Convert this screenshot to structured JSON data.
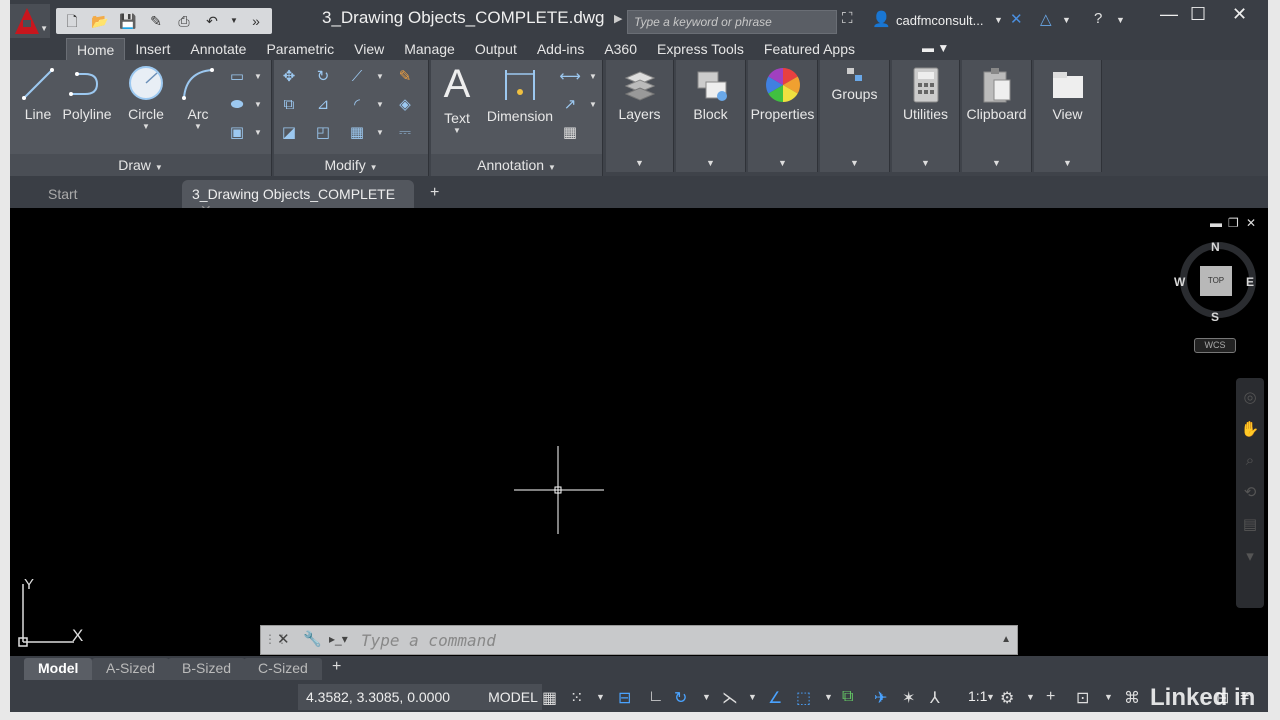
{
  "title_bar": {
    "document_title": "3_Drawing Objects_COMPLETE.dwg",
    "search_placeholder": "Type a keyword or phrase",
    "user_name": "cadfmconsult..."
  },
  "ribbon_tabs": [
    "Home",
    "Insert",
    "Annotate",
    "Parametric",
    "View",
    "Manage",
    "Output",
    "Add-ins",
    "A360",
    "Express Tools",
    "Featured Apps"
  ],
  "active_tab": "Home",
  "draw_panel": {
    "title": "Draw",
    "tools": [
      "Line",
      "Polyline",
      "Circle",
      "Arc"
    ]
  },
  "modify_panel": {
    "title": "Modify"
  },
  "annotation_panel": {
    "title": "Annotation",
    "tools": [
      "Text",
      "Dimension"
    ]
  },
  "big_panels": [
    "Layers",
    "Block",
    "Properties",
    "Groups",
    "Utilities",
    "Clipboard",
    "View"
  ],
  "file_tabs": [
    {
      "label": "Start",
      "active": false
    },
    {
      "label": "3_Drawing Objects_COMPLETE",
      "active": true
    }
  ],
  "viewcube": {
    "north": "N",
    "south": "S",
    "east": "E",
    "west": "W",
    "face": "TOP",
    "ucs": "WCS"
  },
  "ucs_icon": {
    "x": "X",
    "y": "Y"
  },
  "command_line": {
    "placeholder": "Type a command"
  },
  "layout_tabs": [
    {
      "label": "Model",
      "active": true
    },
    {
      "label": "A-Sized",
      "active": false
    },
    {
      "label": "B-Sized",
      "active": false
    },
    {
      "label": "C-Sized",
      "active": false
    }
  ],
  "status_bar": {
    "coordinates": "4.3582, 3.3085, 0.0000",
    "space": "MODEL",
    "annotation_scale": "1:1"
  },
  "watermark": "Linked in"
}
